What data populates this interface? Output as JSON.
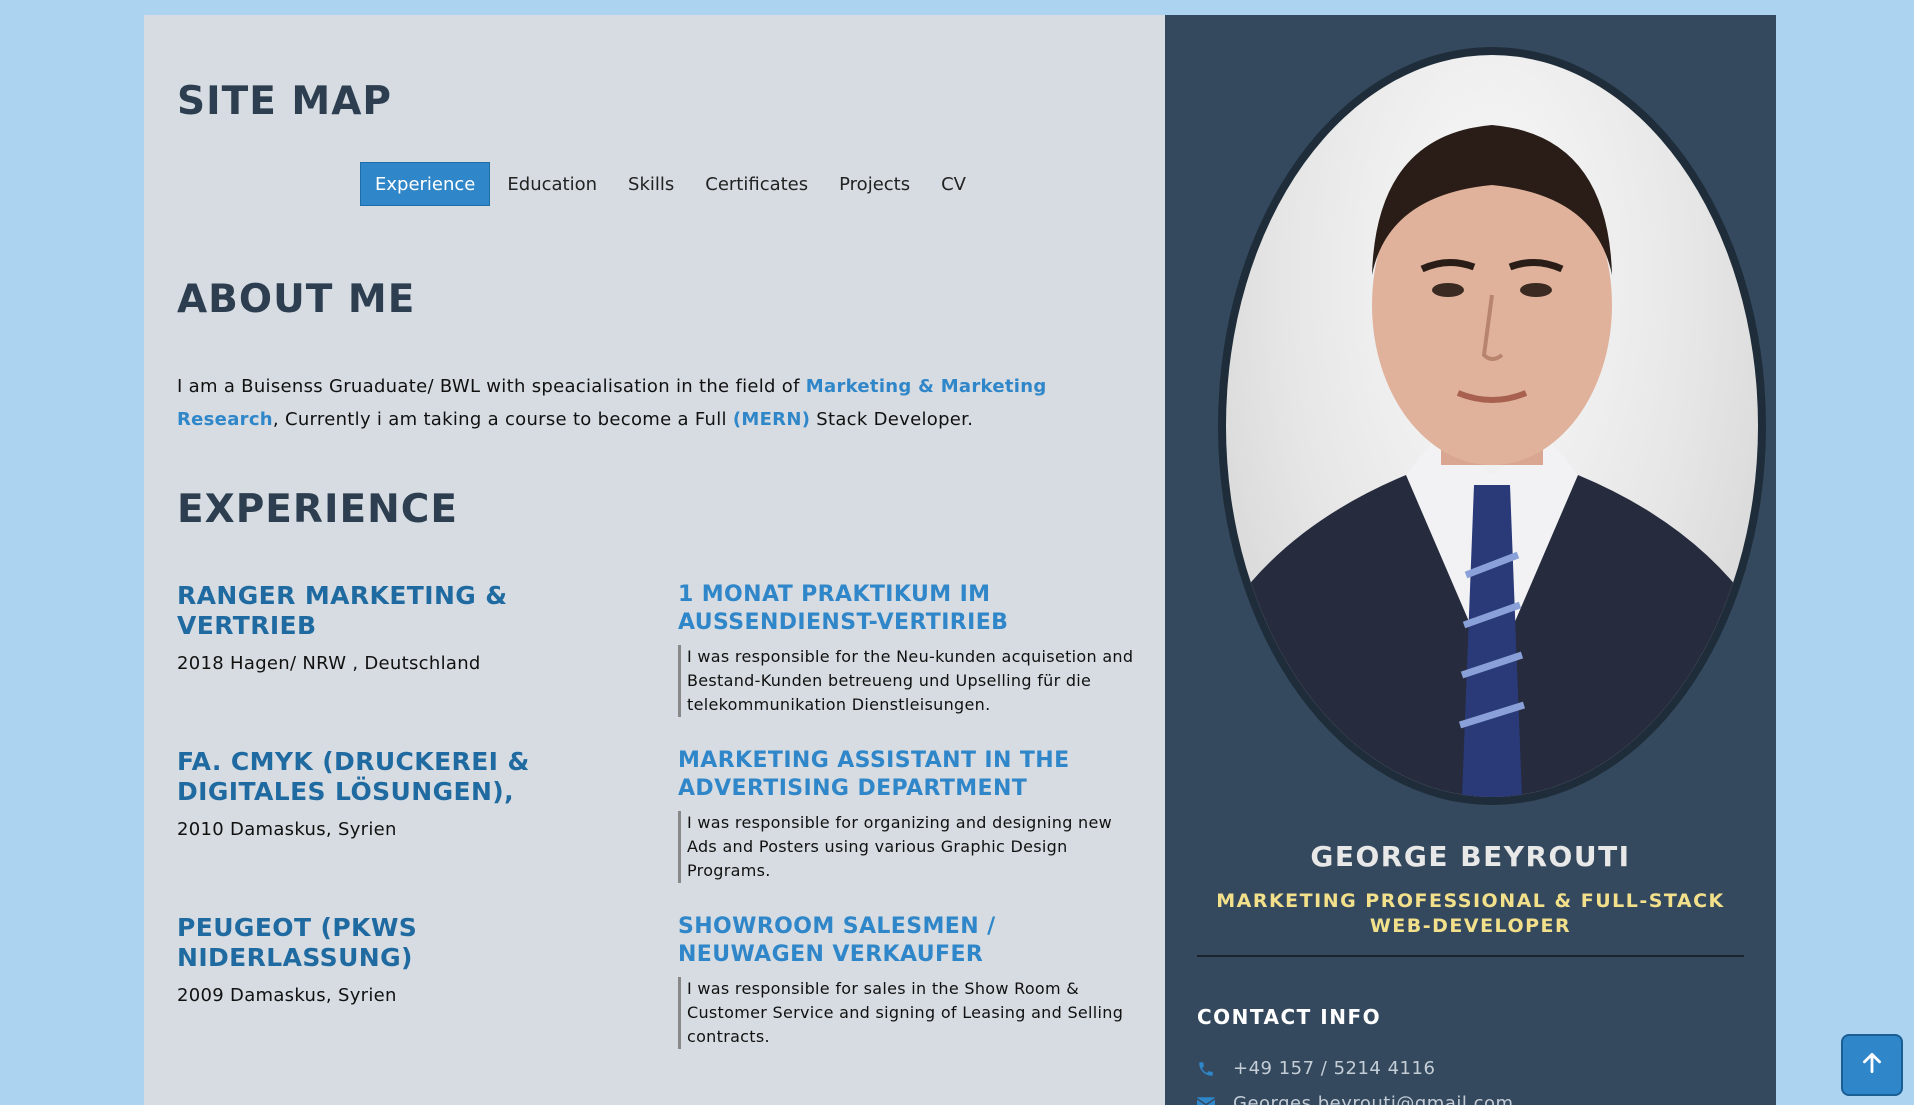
{
  "header": {
    "sitemap_title": "SITE MAP",
    "tabs": [
      {
        "label": "Experience",
        "active": true
      },
      {
        "label": "Education",
        "active": false
      },
      {
        "label": "Skills",
        "active": false
      },
      {
        "label": "Certificates",
        "active": false
      },
      {
        "label": "Projects",
        "active": false
      },
      {
        "label": "CV",
        "active": false
      }
    ]
  },
  "about": {
    "title": "ABOUT ME",
    "text_1": "I am a Buisenss Gruaduate/ BWL with speacialisation in the field of ",
    "highlight_1": "Marketing & Marketing Research",
    "text_2": ", Currently i am taking a course to become a Full ",
    "highlight_2": "(MERN)",
    "text_3": " Stack Developer."
  },
  "experience": {
    "title": "EXPERIENCE",
    "jobs": [
      {
        "company": "RANGER MARKETING & VERTRIEB",
        "meta": "2018 Hagen/ NRW , Deutschland",
        "role": "1 MONAT PRAKTIKUM IM AUSSENDIENST-VERTIRIEB",
        "description": "I was responsible for the Neu-kunden acquisetion and Bestand-Kunden betreueng und Upselling für die telekommunikation Dienstleisungen."
      },
      {
        "company": "FA. CMYK (DRUCKEREI & DIGITALES LÖSUNGEN),",
        "meta": "2010 Damaskus, Syrien",
        "role": "MARKETING ASSISTANT IN THE ADVERTISING DEPARTMENT",
        "description": "I was responsible for organizing and designing new Ads and Posters using various Graphic Design Programs."
      },
      {
        "company": "PEUGEOT (PKWS NIDERLASSUNG)",
        "meta": "2009 Damaskus, Syrien",
        "role": "SHOWROOM SALESMEN / NEUWAGEN VERKAUFER",
        "description": "I was responsible for sales in the Show Room & Customer Service and signing of Leasing and Selling contracts."
      }
    ]
  },
  "profile": {
    "name": "GEORGE BEYROUTI",
    "title": "MARKETING PROFESSIONAL & FULL-STACK WEB-DEVELOPER",
    "contact_title": "CONTACT INFO",
    "phone": "+49 157 / 5214 4116",
    "email": "Georges.beyrouti@gmail.com",
    "icons": {
      "phone": "phone-icon",
      "email": "envelope-icon",
      "scroll_top": "arrow-up-icon"
    }
  },
  "colors": {
    "accent": "#2f86c9",
    "heading": "#2c3e50",
    "sidebar": "#34495e",
    "title_gold": "#f3e08a",
    "page_bg": "#acd4f1"
  }
}
